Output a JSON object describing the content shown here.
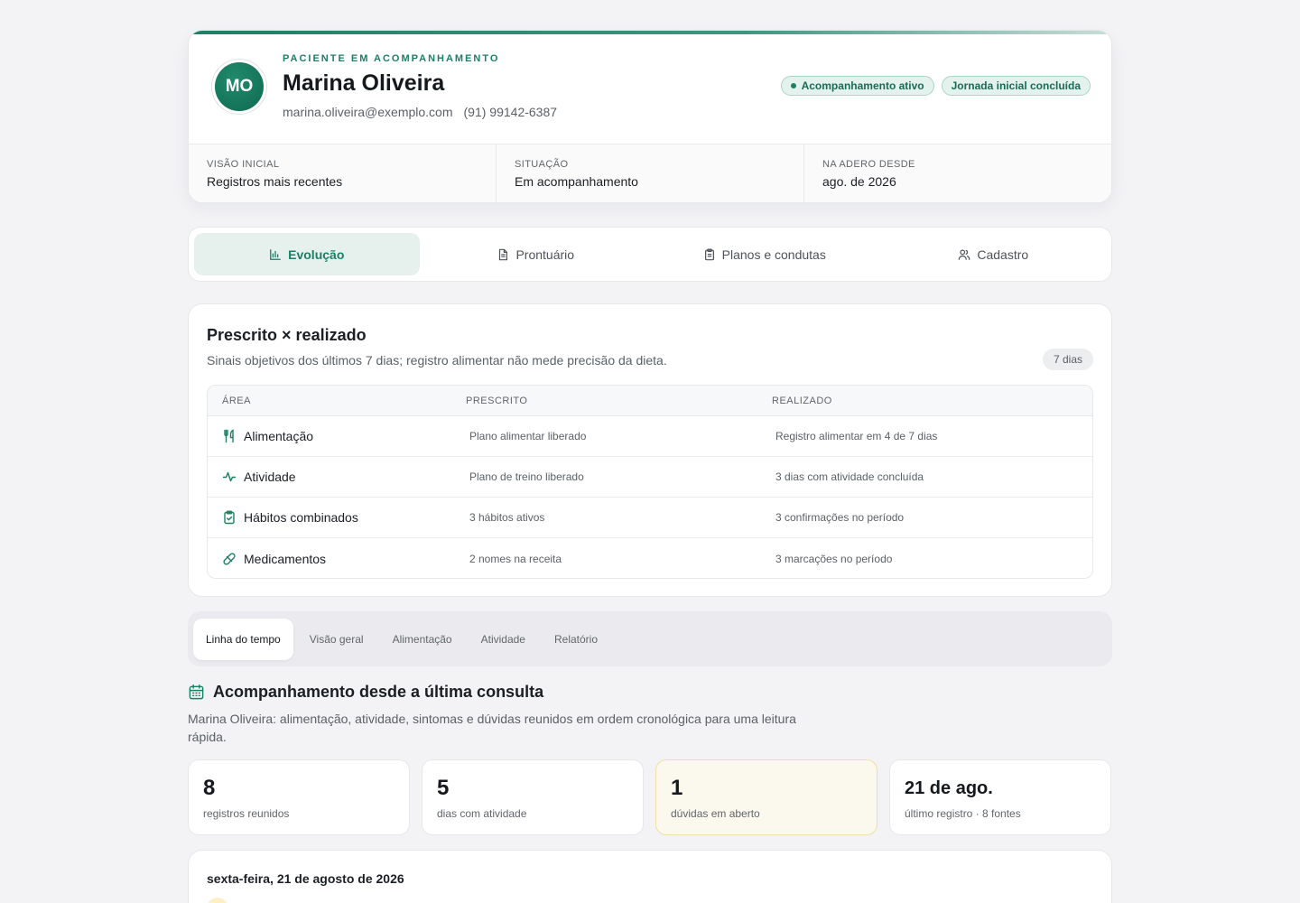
{
  "patient": {
    "initials": "MO",
    "eyebrow": "PACIENTE EM ACOMPANHAMENTO",
    "name": "Marina Oliveira",
    "email": "marina.oliveira@exemplo.com",
    "phone": "(91) 99142-6387",
    "badges": [
      "Acompanhamento ativo",
      "Jornada inicial concluída"
    ],
    "meta": [
      {
        "label": "VISÃO INICIAL",
        "value": "Registros mais recentes"
      },
      {
        "label": "SITUAÇÃO",
        "value": "Em acompanhamento"
      },
      {
        "label": "NA ADERO DESDE",
        "value": "ago. de 2026"
      }
    ]
  },
  "main_tabs": [
    {
      "label": "Evolução",
      "icon": "bar-chart-icon"
    },
    {
      "label": "Prontuário",
      "icon": "file-icon"
    },
    {
      "label": "Planos e condutas",
      "icon": "clipboard-icon"
    },
    {
      "label": "Cadastro",
      "icon": "users-icon"
    }
  ],
  "prescribed": {
    "title": "Prescrito × realizado",
    "subtitle": "Sinais objetivos dos últimos 7 dias; registro alimentar não mede precisão da dieta.",
    "period": "7 dias",
    "headers": [
      "ÁREA",
      "PRESCRITO",
      "REALIZADO"
    ],
    "rows": [
      {
        "area": "Alimentação",
        "icon": "utensils-icon",
        "prescribed": "Plano alimentar liberado",
        "done": "Registro alimentar em 4 de 7 dias"
      },
      {
        "area": "Atividade",
        "icon": "activity-icon",
        "prescribed": "Plano de treino liberado",
        "done": "3 dias com atividade concluída"
      },
      {
        "area": "Hábitos combinados",
        "icon": "clipboard-check-icon",
        "prescribed": "3 hábitos ativos",
        "done": "3 confirmações no período"
      },
      {
        "area": "Medicamentos",
        "icon": "pill-icon",
        "prescribed": "2 nomes na receita",
        "done": "3 marcações no período"
      }
    ]
  },
  "sub_tabs": [
    "Linha do tempo",
    "Visão geral",
    "Alimentação",
    "Atividade",
    "Relatório"
  ],
  "section": {
    "title": "Acompanhamento desde a última consulta",
    "description": "Marina Oliveira: alimentação, atividade, sintomas e dúvidas reunidos em ordem cronológica para uma leitura rápida."
  },
  "stats": [
    {
      "value": "8",
      "label": "registros reunidos"
    },
    {
      "value": "5",
      "label": "dias com atividade"
    },
    {
      "value": "1",
      "label": "dúvidas em aberto"
    },
    {
      "value": "21 de ago.",
      "label": "último registro · 8 fontes"
    }
  ],
  "timeline": {
    "day": "sexta-feira, 21 de agosto de 2026"
  },
  "colors": {
    "accent": "#1d7f64",
    "accent_soft": "#e6f1ee",
    "warn_soft": "#fbf8ee",
    "background": "#f3f3f6"
  }
}
